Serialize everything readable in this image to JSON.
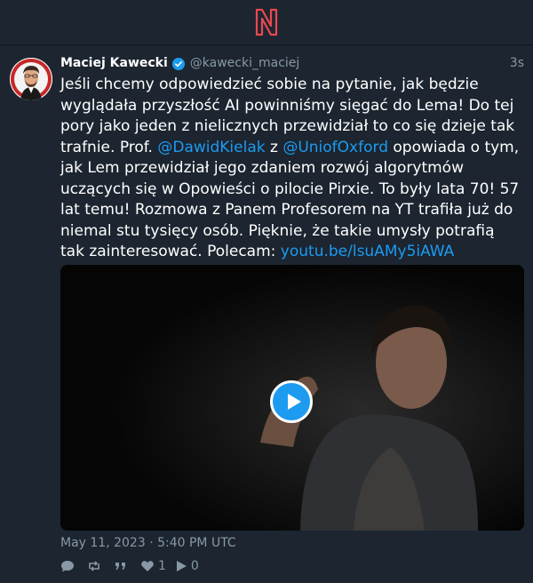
{
  "app": {
    "logo_letter": "N"
  },
  "tweet": {
    "display_name": "Maciej Kawecki",
    "handle": "@kawecki_maciej",
    "relative_time": "3s",
    "text_parts": {
      "p1": "Jeśli chcemy odpowiedzieć sobie na pytanie, jak będzie wyglądała przyszłość AI powinniśmy sięgać do Lema! Do tej pory jako jeden z nielicznych przewidział to co się dzieje tak trafnie. Prof. ",
      "mention1": "@DawidKielak",
      "p2": " z ",
      "mention2": "@UniofOxford",
      "p3": " opowiada o tym, jak Lem przewidział jego zdaniem rozwój algorytmów uczących się w Opowieści o pilocie Pirxie. To były lata 70! 57 lat temu! Rozmowa z Panem Profesorem na YT trafiła już do niemal stu tysięcy osób. Pięknie, że takie umysły potrafią tak zainteresować. Polecam: ",
      "link": "youtu.be/lsuAMy5iAWA"
    },
    "date": "May 11, 2023 · 5:40 PM UTC",
    "actions": {
      "reply_count": "",
      "retweet_count": "",
      "quote_count": "",
      "like_count": "1",
      "play_count": "0"
    }
  },
  "colors": {
    "background": "#1c2530",
    "accent": "#1d9bf0",
    "logo": "#e8494f",
    "muted": "#8899a6"
  },
  "icons": [
    "nitter-logo",
    "verified-badge-icon",
    "comment-icon",
    "retweet-icon",
    "quote-icon",
    "heart-icon",
    "play-icon",
    "video-play-button-icon"
  ]
}
